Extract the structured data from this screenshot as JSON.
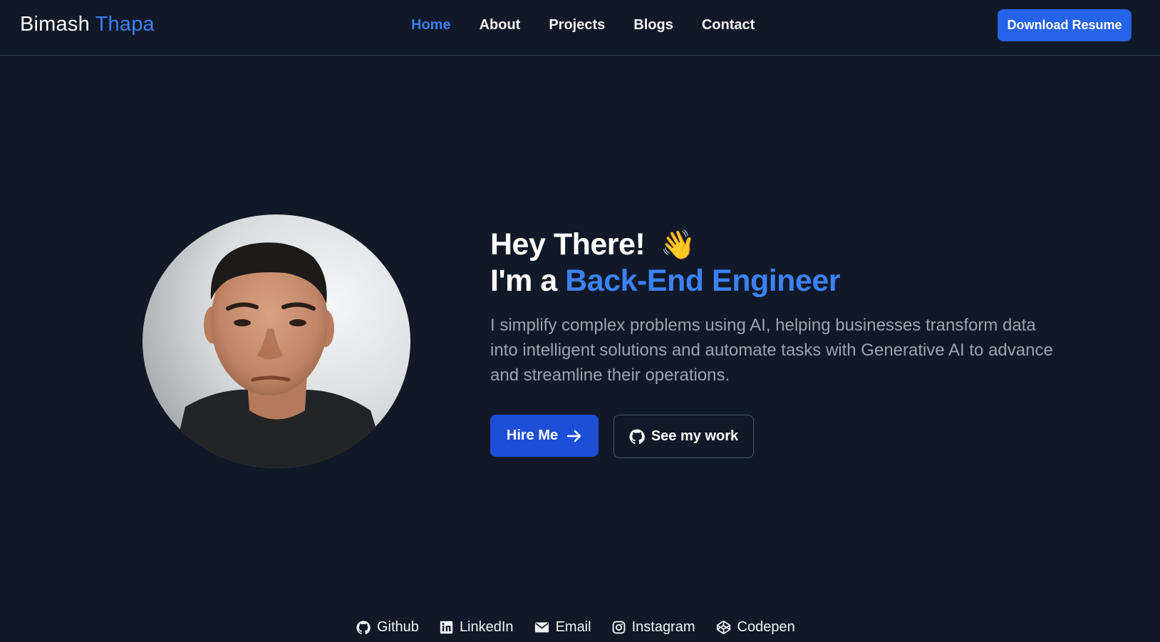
{
  "header": {
    "brand_first": "Bimash",
    "brand_last": "Thapa",
    "nav": [
      {
        "label": "Home",
        "active": true
      },
      {
        "label": "About",
        "active": false
      },
      {
        "label": "Projects",
        "active": false
      },
      {
        "label": "Blogs",
        "active": false
      },
      {
        "label": "Contact",
        "active": false
      }
    ],
    "download_label": "Download Resume"
  },
  "hero": {
    "greeting": "Hey There!",
    "wave_emoji": "👋",
    "intro_prefix": "I'm a",
    "role": "Back-End Engineer",
    "description": "I simplify complex problems using AI, helping businesses transform data into intelligent solutions and automate tasks with Generative AI to advance and streamline their operations.",
    "hire_label": "Hire Me",
    "work_label": "See my work"
  },
  "socials": [
    {
      "label": "Github",
      "icon": "github-icon"
    },
    {
      "label": "LinkedIn",
      "icon": "linkedin-icon"
    },
    {
      "label": "Email",
      "icon": "email-icon"
    },
    {
      "label": "Instagram",
      "icon": "instagram-icon"
    },
    {
      "label": "Codepen",
      "icon": "codepen-icon"
    }
  ],
  "colors": {
    "background": "#111827",
    "accent": "#3b82f6",
    "primary_button": "#2563eb",
    "muted_text": "#9ca3af"
  }
}
